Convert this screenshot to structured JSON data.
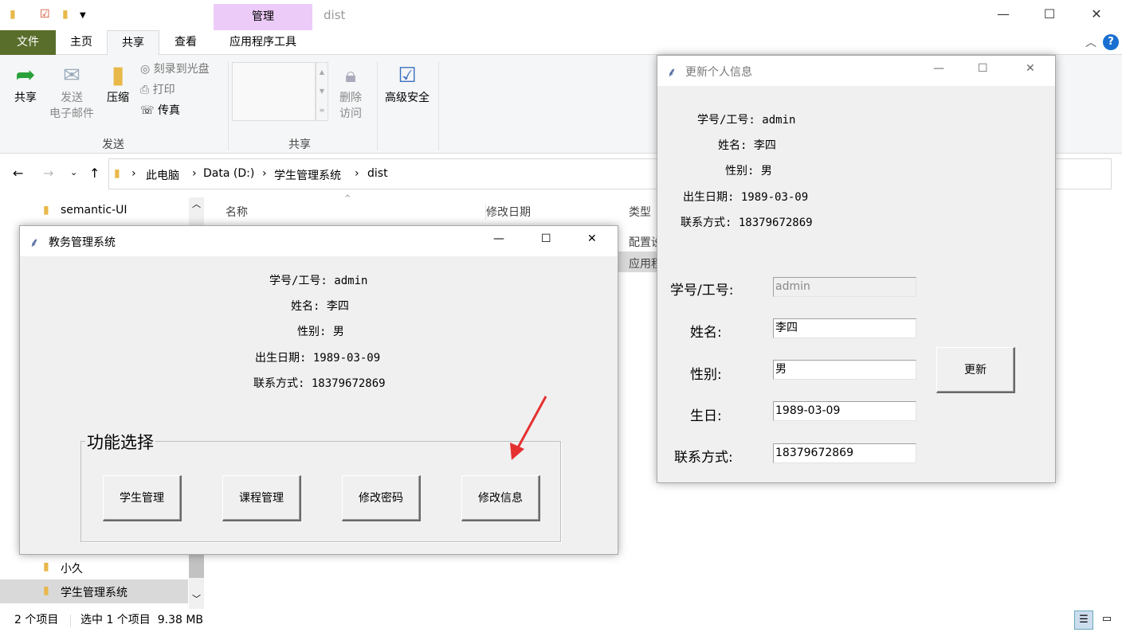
{
  "explorer": {
    "context_tab": "管理",
    "window_title": "dist",
    "tabs": [
      "文件",
      "主页",
      "共享",
      "查看",
      "应用程序工具"
    ],
    "ribbon": {
      "share": "共享",
      "send_email_1": "发送",
      "send_email_2": "电子邮件",
      "zip": "压缩",
      "burn": "刻录到光盘",
      "print": "打印",
      "fax": "传真",
      "group_send": "发送",
      "remove_1": "删除",
      "remove_2": "访问",
      "advanced_security": "高级安全",
      "group_share": "共享"
    },
    "breadcrumb": [
      "此电脑",
      "Data (D:)",
      "学生管理系统",
      "dist"
    ],
    "nav_items": [
      "semantic-UI",
      "小久",
      "学生管理系统"
    ],
    "columns": [
      "名称",
      "修改日期",
      "类型"
    ],
    "rows_type": [
      "配置设",
      "应用程"
    ],
    "status": {
      "count": "2 个项目",
      "selected": "选中 1 个项目  9.38 MB"
    },
    "accent": "#1e7a3a"
  },
  "main_window": {
    "title": "教务管理系统",
    "info": {
      "id_label": "学号/工号:",
      "id": "admin",
      "name_label": "姓名:",
      "name": "李四",
      "sex_label": "性别:",
      "sex": "男",
      "birth_label": "出生日期:",
      "birth": "1989-03-09",
      "phone_label": "联系方式:",
      "phone": "18379672869"
    },
    "group_label": "功能选择",
    "buttons": [
      "学生管理",
      "课程管理",
      "修改密码",
      "修改信息"
    ]
  },
  "update_window": {
    "title": "更新个人信息",
    "info": {
      "id_label": "学号/工号:",
      "id": "admin",
      "name_label": "姓名:",
      "name": "李四",
      "sex_label": "性别:",
      "sex": "男",
      "birth_label": "出生日期:",
      "birth": "1989-03-09",
      "phone_label": "联系方式:",
      "phone": "18379672869"
    },
    "form": {
      "id_label": "学号/工号:",
      "id": "admin",
      "name_label": "姓名:",
      "name": "李四",
      "sex_label": "性别:",
      "sex": "男",
      "birth_label": "生日:",
      "birth": "1989-03-09",
      "phone_label": "联系方式:",
      "phone": "18379672869"
    },
    "update_button": "更新"
  }
}
